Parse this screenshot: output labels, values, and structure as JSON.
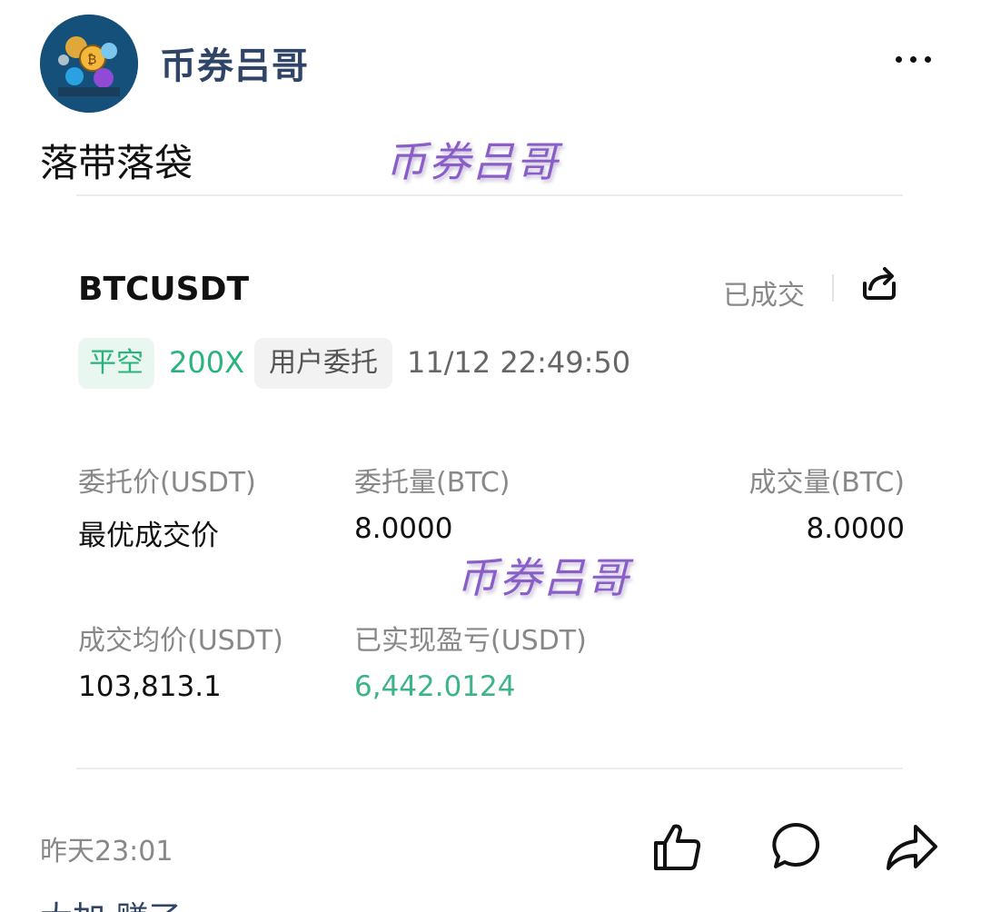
{
  "author": {
    "name": "币券吕哥",
    "avatar": "crypto-avatar"
  },
  "post": {
    "text": "落带落袋",
    "watermark": "币券吕哥"
  },
  "order": {
    "symbol": "BTCUSDT",
    "status": "已成交",
    "side_tag": "平空",
    "leverage": "200X",
    "order_type": "用户委托",
    "time": "11/12 22:49:50",
    "fields": {
      "order_price_label": "委托价(USDT)",
      "order_price": "最优成交价",
      "order_qty_label": "委托量(BTC)",
      "order_qty": "8.0000",
      "filled_qty_label": "成交量(BTC)",
      "filled_qty": "8.0000",
      "avg_price_label": "成交均价(USDT)",
      "avg_price": "103,813.1",
      "realized_pnl_label": "已实现盈亏(USDT)",
      "realized_pnl": "6,442.0124"
    }
  },
  "footer": {
    "time": "昨天23:01",
    "actions": [
      "thumbs-up-icon",
      "comment-icon",
      "share-icon"
    ]
  },
  "next_comment": {
    "text": "大加 赚了"
  },
  "colors": {
    "accent_green": "#2bb37d",
    "pnl_green": "#3bb486",
    "author": "#2f4466",
    "watermark": "#8a5ec7"
  }
}
